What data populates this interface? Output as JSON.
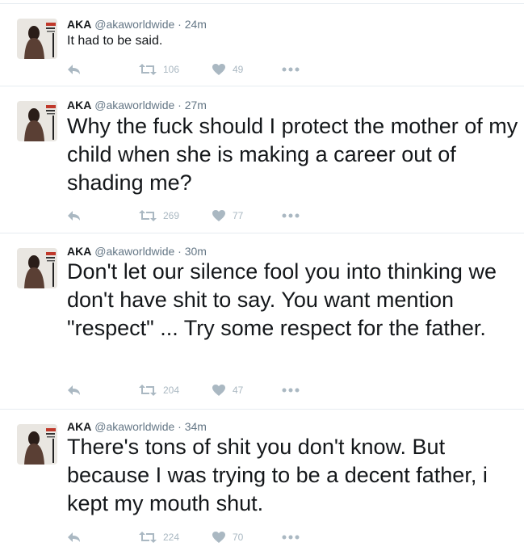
{
  "tweets": [
    {
      "name": "AKA",
      "handle": "@akaworldwide",
      "time": "24m",
      "text": "It had to be said.",
      "retweets": "106",
      "likes": "49"
    },
    {
      "name": "AKA",
      "handle": "@akaworldwide",
      "time": "27m",
      "text": "Why the fuck should I protect the mother of my child when she is making a career out of shading me?",
      "retweets": "269",
      "likes": "77"
    },
    {
      "name": "AKA",
      "handle": "@akaworldwide",
      "time": "30m",
      "text": "Don't let our silence fool you into thinking we don't have shit to say. You want mention \"respect\" ... Try some respect for the father.",
      "retweets": "204",
      "likes": "47"
    },
    {
      "name": "AKA",
      "handle": "@akaworldwide",
      "time": "34m",
      "text": "There's tons of shit you don't know. But because I was trying to be a decent father, i kept my mouth shut.",
      "retweets": "224",
      "likes": "70"
    }
  ],
  "icons": {
    "reply": "reply-icon",
    "retweet": "retweet-icon",
    "like": "heart-icon",
    "more": "more-dots-icon"
  },
  "colors": {
    "icon": "#aab8c2",
    "meta": "#657786",
    "divider": "#e6ecf0",
    "text": "#14171a"
  }
}
